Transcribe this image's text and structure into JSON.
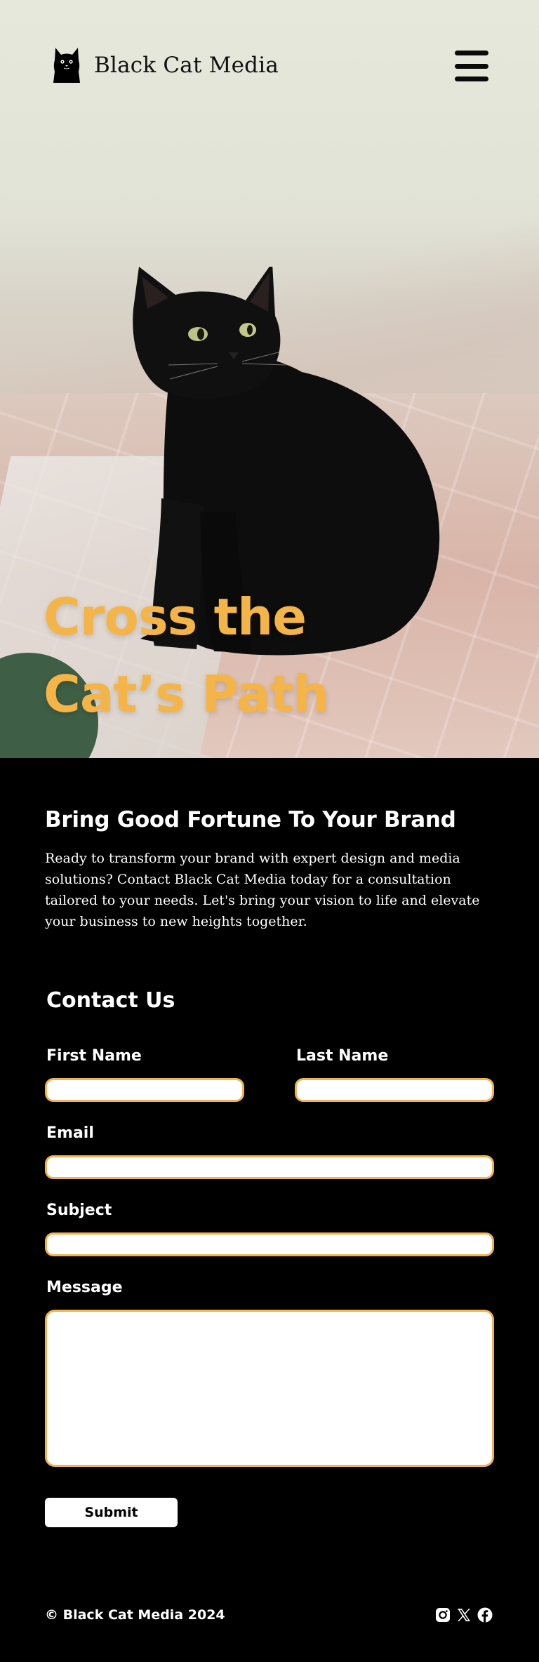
{
  "header": {
    "brand_name": "Black Cat Media",
    "logo_icon": "black-cat-icon",
    "menu_icon": "hamburger-menu-icon"
  },
  "hero": {
    "title_line1": "Cross the",
    "title_line2": "Cat’s Path",
    "image": "black-cat-photo"
  },
  "intro": {
    "heading": "Bring Good Fortune To Your Brand",
    "body": "Ready to transform your brand with expert design and media solutions? Contact Black Cat Media today for a consultation tailored to your needs. Let's bring your vision to life and elevate your business to new heights together."
  },
  "contact_form": {
    "title": "Contact Us",
    "first_name_label": "First Name",
    "first_name_value": "",
    "last_name_label": "Last Name",
    "last_name_value": "",
    "email_label": "Email",
    "email_value": "",
    "subject_label": "Subject",
    "subject_value": "",
    "message_label": "Message",
    "message_value": "",
    "submit_label": "Submit"
  },
  "footer": {
    "copyright": "© Black Cat Media 2024",
    "social_icons": [
      "instagram-icon",
      "x-twitter-icon",
      "facebook-icon"
    ]
  },
  "colors": {
    "accent": "#f4b447",
    "field_border": "#f2b24e",
    "background": "#000000",
    "text_light": "#ffffff"
  }
}
